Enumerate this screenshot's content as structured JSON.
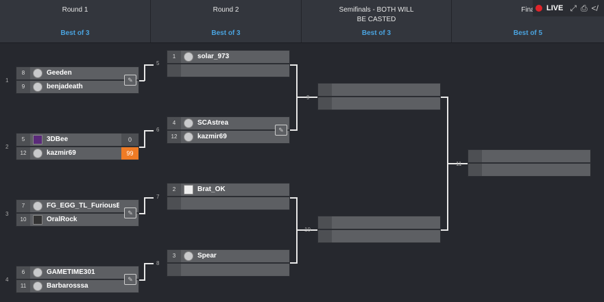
{
  "header": {
    "columns": [
      {
        "title": "Round 1",
        "best": "Best of 3"
      },
      {
        "title": "Round 2",
        "best": "Best of 3"
      },
      {
        "title": "Semifinals - BOTH WILL BE CASTED",
        "best": "Best of 3"
      },
      {
        "title": "Fina",
        "best": "Best of 5"
      }
    ],
    "toolbar": {
      "live_label": "LIVE"
    }
  },
  "matches": {
    "m1": {
      "number": "1",
      "p1": {
        "seed": "8",
        "name": "Geeden"
      },
      "p2": {
        "seed": "9",
        "name": "benjadeath"
      }
    },
    "m2": {
      "number": "2",
      "p1": {
        "seed": "5",
        "name": "3DBee",
        "score": "0"
      },
      "p2": {
        "seed": "12",
        "name": "kazmir69",
        "score": "99"
      }
    },
    "m3": {
      "number": "3",
      "p1": {
        "seed": "7",
        "name": "FG_EGG_TL_FuriousEgg"
      },
      "p2": {
        "seed": "10",
        "name": "OralRock"
      }
    },
    "m4": {
      "number": "4",
      "p1": {
        "seed": "6",
        "name": "GAMETIME301"
      },
      "p2": {
        "seed": "11",
        "name": "Barbarosssa"
      }
    },
    "m5": {
      "number": "5",
      "p1": {
        "seed": "1",
        "name": "solar_973"
      },
      "p2": {
        "seed": "",
        "name": ""
      }
    },
    "m6": {
      "number": "6",
      "p1": {
        "seed": "4",
        "name": "SCAstrea"
      },
      "p2": {
        "seed": "12",
        "name": "kazmir69"
      }
    },
    "m7": {
      "number": "7",
      "p1": {
        "seed": "2",
        "name": "Brat_OK"
      },
      "p2": {
        "seed": "",
        "name": ""
      }
    },
    "m8": {
      "number": "8",
      "p1": {
        "seed": "3",
        "name": "Spear"
      },
      "p2": {
        "seed": "",
        "name": ""
      }
    },
    "m9": {
      "number": "9"
    },
    "m10": {
      "number": "10"
    },
    "m11": {
      "number": "11"
    }
  }
}
